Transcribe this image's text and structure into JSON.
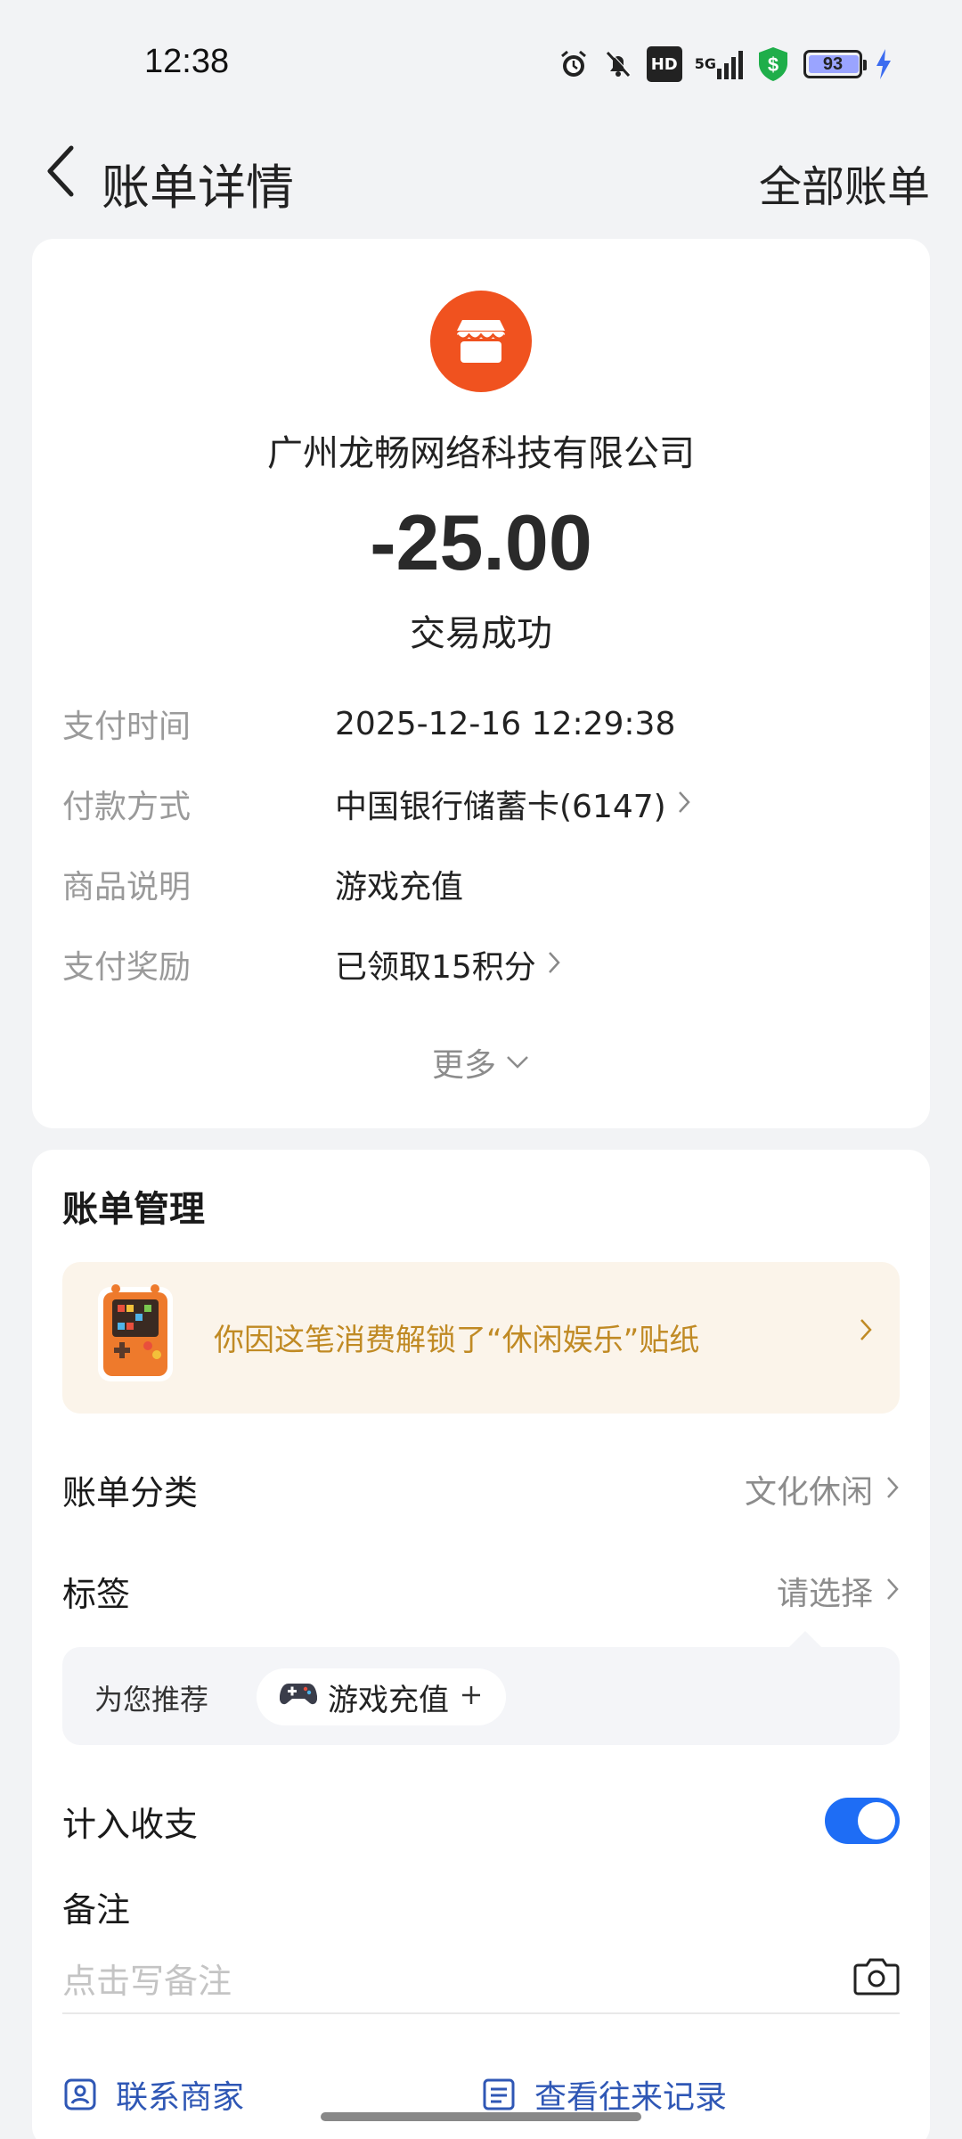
{
  "status_bar": {
    "time": "12:38",
    "battery_level": "93",
    "network": "5G",
    "hd_label": "HD",
    "icons": [
      "alarm-icon",
      "mute-icon",
      "hd-icon",
      "signal-icon",
      "shield-icon",
      "battery-icon",
      "charging-icon"
    ]
  },
  "header": {
    "title": "账单详情",
    "right_action": "全部账单"
  },
  "transaction": {
    "merchant": "广州龙畅网络科技有限公司",
    "amount": "-25.00",
    "status": "交易成功",
    "details": [
      {
        "label": "支付时间",
        "value": "2025-12-16 12:29:38"
      },
      {
        "label": "付款方式",
        "value": "中国银行储蓄卡(6147)"
      },
      {
        "label": "商品说明",
        "value": "游戏充值"
      },
      {
        "label": "支付奖励",
        "value": "已领取15积分"
      }
    ],
    "more_label": "更多"
  },
  "management": {
    "title": "账单管理",
    "sticker_text": "你因这笔消费解锁了“休闲娱乐”贴纸",
    "category_label": "账单分类",
    "category_value": "文化休闲",
    "tag_label": "标签",
    "tag_value": "请选择",
    "recommend_label": "为您推荐",
    "recommend_chip": "游戏充值",
    "include_label": "计入收支",
    "include_on": true,
    "remark_label": "备注",
    "remark_placeholder": "点击写备注",
    "actions": [
      "联系商家",
      "查看往来记录"
    ]
  },
  "colors": {
    "accent": "#1e6df5",
    "merchant_icon": "#f0521f",
    "sticker_text": "#c08a24",
    "link": "#2f57b5"
  }
}
